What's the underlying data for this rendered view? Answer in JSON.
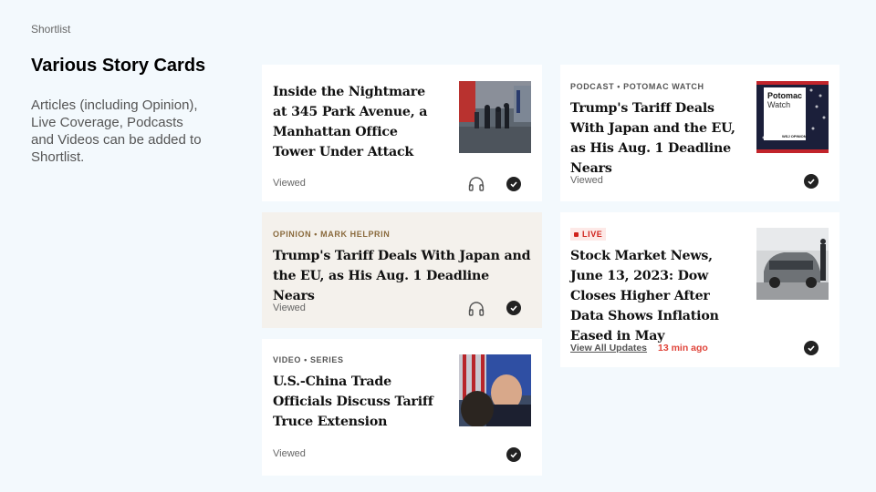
{
  "page": {
    "eyebrow": "Shortlist",
    "title": "Various Story Cards",
    "description": "Articles (including Opinion), Live Coverage, Podcasts and Videos can be added to Shortlist."
  },
  "cards": {
    "article1": {
      "headline": "Inside the Nightmare at 345 Park Avenue, a Manhattan Office Tower Under Attack",
      "status": "Viewed",
      "thumb": "police-street-scene-photo"
    },
    "opinion": {
      "label": "OPINION • MARK HELPRIN",
      "headline": "Trump's Tariff Deals With Japan and the EU, as His Aug. 1 Deadline Nears",
      "status": "Viewed"
    },
    "video": {
      "label": "VIDEO • SERIES",
      "headline": "U.S.-China Trade Officials Discuss Tariff Truce Extension",
      "status": "Viewed",
      "thumb": "officials-with-flags-photo"
    },
    "podcast": {
      "label": "PODCAST • POTOMAC WATCH",
      "headline": "Trump's Tariff Deals With Japan and the EU, as His Aug. 1 Deadline Nears",
      "status": "Viewed",
      "cover_title": "Potomac",
      "cover_subtitle": "Watch",
      "cover_brand": "WSJ OPINION"
    },
    "live": {
      "badge": "LIVE",
      "headline": "Stock Market News, June 13, 2023: Dow Closes Higher After Data Shows Inflation Eased in May",
      "link": "View All Updates",
      "time": "13 min ago",
      "thumb": "car-showroom-photo"
    }
  },
  "colors": {
    "background": "#f3f9fd",
    "opinion_tint": "#f4f1ec",
    "live_red": "#d0221c",
    "time_red": "#e0453b",
    "opinion_label": "#8a6a3d"
  }
}
